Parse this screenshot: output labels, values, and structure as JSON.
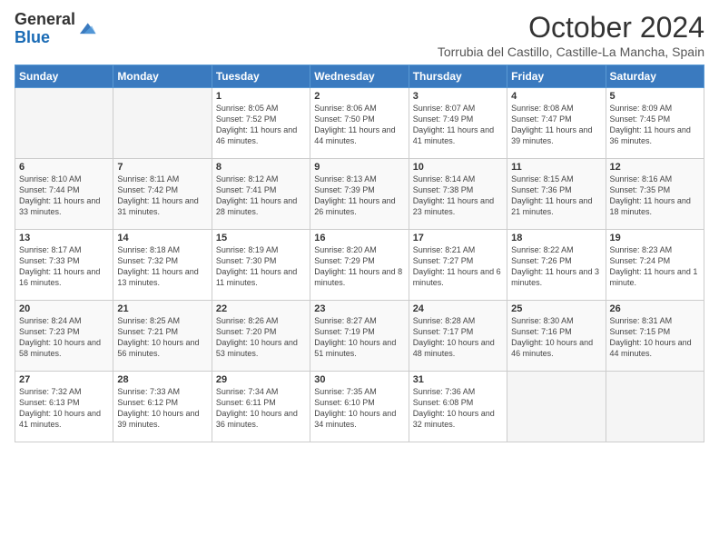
{
  "logo": {
    "general": "General",
    "blue": "Blue"
  },
  "header": {
    "month": "October 2024",
    "location": "Torrubia del Castillo, Castille-La Mancha, Spain"
  },
  "weekdays": [
    "Sunday",
    "Monday",
    "Tuesday",
    "Wednesday",
    "Thursday",
    "Friday",
    "Saturday"
  ],
  "weeks": [
    [
      {
        "day": "",
        "empty": true
      },
      {
        "day": "",
        "empty": true
      },
      {
        "day": "1",
        "sunrise": "Sunrise: 8:05 AM",
        "sunset": "Sunset: 7:52 PM",
        "daylight": "Daylight: 11 hours and 46 minutes."
      },
      {
        "day": "2",
        "sunrise": "Sunrise: 8:06 AM",
        "sunset": "Sunset: 7:50 PM",
        "daylight": "Daylight: 11 hours and 44 minutes."
      },
      {
        "day": "3",
        "sunrise": "Sunrise: 8:07 AM",
        "sunset": "Sunset: 7:49 PM",
        "daylight": "Daylight: 11 hours and 41 minutes."
      },
      {
        "day": "4",
        "sunrise": "Sunrise: 8:08 AM",
        "sunset": "Sunset: 7:47 PM",
        "daylight": "Daylight: 11 hours and 39 minutes."
      },
      {
        "day": "5",
        "sunrise": "Sunrise: 8:09 AM",
        "sunset": "Sunset: 7:45 PM",
        "daylight": "Daylight: 11 hours and 36 minutes."
      }
    ],
    [
      {
        "day": "6",
        "sunrise": "Sunrise: 8:10 AM",
        "sunset": "Sunset: 7:44 PM",
        "daylight": "Daylight: 11 hours and 33 minutes."
      },
      {
        "day": "7",
        "sunrise": "Sunrise: 8:11 AM",
        "sunset": "Sunset: 7:42 PM",
        "daylight": "Daylight: 11 hours and 31 minutes."
      },
      {
        "day": "8",
        "sunrise": "Sunrise: 8:12 AM",
        "sunset": "Sunset: 7:41 PM",
        "daylight": "Daylight: 11 hours and 28 minutes."
      },
      {
        "day": "9",
        "sunrise": "Sunrise: 8:13 AM",
        "sunset": "Sunset: 7:39 PM",
        "daylight": "Daylight: 11 hours and 26 minutes."
      },
      {
        "day": "10",
        "sunrise": "Sunrise: 8:14 AM",
        "sunset": "Sunset: 7:38 PM",
        "daylight": "Daylight: 11 hours and 23 minutes."
      },
      {
        "day": "11",
        "sunrise": "Sunrise: 8:15 AM",
        "sunset": "Sunset: 7:36 PM",
        "daylight": "Daylight: 11 hours and 21 minutes."
      },
      {
        "day": "12",
        "sunrise": "Sunrise: 8:16 AM",
        "sunset": "Sunset: 7:35 PM",
        "daylight": "Daylight: 11 hours and 18 minutes."
      }
    ],
    [
      {
        "day": "13",
        "sunrise": "Sunrise: 8:17 AM",
        "sunset": "Sunset: 7:33 PM",
        "daylight": "Daylight: 11 hours and 16 minutes."
      },
      {
        "day": "14",
        "sunrise": "Sunrise: 8:18 AM",
        "sunset": "Sunset: 7:32 PM",
        "daylight": "Daylight: 11 hours and 13 minutes."
      },
      {
        "day": "15",
        "sunrise": "Sunrise: 8:19 AM",
        "sunset": "Sunset: 7:30 PM",
        "daylight": "Daylight: 11 hours and 11 minutes."
      },
      {
        "day": "16",
        "sunrise": "Sunrise: 8:20 AM",
        "sunset": "Sunset: 7:29 PM",
        "daylight": "Daylight: 11 hours and 8 minutes."
      },
      {
        "day": "17",
        "sunrise": "Sunrise: 8:21 AM",
        "sunset": "Sunset: 7:27 PM",
        "daylight": "Daylight: 11 hours and 6 minutes."
      },
      {
        "day": "18",
        "sunrise": "Sunrise: 8:22 AM",
        "sunset": "Sunset: 7:26 PM",
        "daylight": "Daylight: 11 hours and 3 minutes."
      },
      {
        "day": "19",
        "sunrise": "Sunrise: 8:23 AM",
        "sunset": "Sunset: 7:24 PM",
        "daylight": "Daylight: 11 hours and 1 minute."
      }
    ],
    [
      {
        "day": "20",
        "sunrise": "Sunrise: 8:24 AM",
        "sunset": "Sunset: 7:23 PM",
        "daylight": "Daylight: 10 hours and 58 minutes."
      },
      {
        "day": "21",
        "sunrise": "Sunrise: 8:25 AM",
        "sunset": "Sunset: 7:21 PM",
        "daylight": "Daylight: 10 hours and 56 minutes."
      },
      {
        "day": "22",
        "sunrise": "Sunrise: 8:26 AM",
        "sunset": "Sunset: 7:20 PM",
        "daylight": "Daylight: 10 hours and 53 minutes."
      },
      {
        "day": "23",
        "sunrise": "Sunrise: 8:27 AM",
        "sunset": "Sunset: 7:19 PM",
        "daylight": "Daylight: 10 hours and 51 minutes."
      },
      {
        "day": "24",
        "sunrise": "Sunrise: 8:28 AM",
        "sunset": "Sunset: 7:17 PM",
        "daylight": "Daylight: 10 hours and 48 minutes."
      },
      {
        "day": "25",
        "sunrise": "Sunrise: 8:30 AM",
        "sunset": "Sunset: 7:16 PM",
        "daylight": "Daylight: 10 hours and 46 minutes."
      },
      {
        "day": "26",
        "sunrise": "Sunrise: 8:31 AM",
        "sunset": "Sunset: 7:15 PM",
        "daylight": "Daylight: 10 hours and 44 minutes."
      }
    ],
    [
      {
        "day": "27",
        "sunrise": "Sunrise: 7:32 AM",
        "sunset": "Sunset: 6:13 PM",
        "daylight": "Daylight: 10 hours and 41 minutes."
      },
      {
        "day": "28",
        "sunrise": "Sunrise: 7:33 AM",
        "sunset": "Sunset: 6:12 PM",
        "daylight": "Daylight: 10 hours and 39 minutes."
      },
      {
        "day": "29",
        "sunrise": "Sunrise: 7:34 AM",
        "sunset": "Sunset: 6:11 PM",
        "daylight": "Daylight: 10 hours and 36 minutes."
      },
      {
        "day": "30",
        "sunrise": "Sunrise: 7:35 AM",
        "sunset": "Sunset: 6:10 PM",
        "daylight": "Daylight: 10 hours and 34 minutes."
      },
      {
        "day": "31",
        "sunrise": "Sunrise: 7:36 AM",
        "sunset": "Sunset: 6:08 PM",
        "daylight": "Daylight: 10 hours and 32 minutes."
      },
      {
        "day": "",
        "empty": true
      },
      {
        "day": "",
        "empty": true
      }
    ]
  ]
}
